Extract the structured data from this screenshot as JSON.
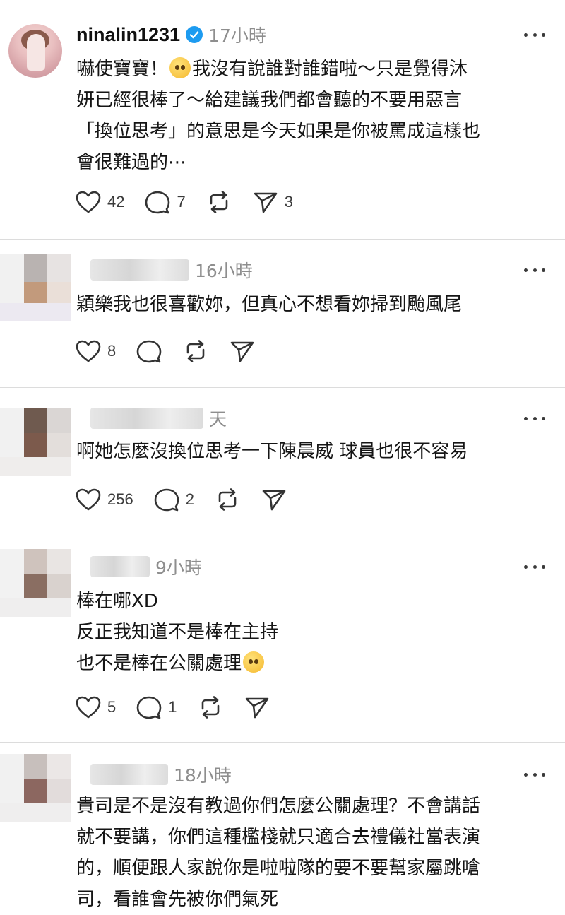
{
  "posts": [
    {
      "username": "ninalin1231",
      "verified": true,
      "time": "17小時",
      "text_before_emoji": "嚇使寶寶！",
      "text_after_emoji": "我沒有說誰對誰錯啦～只是覺得沐\n妍已經很棒了～給建議我們都會聽的不要用惡言\n「換位思考」的意思是今天如果是你被罵成這樣也\n會很難過的⋯",
      "emoji": "pleading-face-icon",
      "likes": "42",
      "replies": "7",
      "shares": "3"
    },
    {
      "time": "16小時",
      "text": "穎樂我也很喜歡妳，但真心不想看妳掃到颱風尾",
      "likes": "8"
    },
    {
      "time": "天",
      "text": "啊她怎麼沒換位思考一下陳晨威 球員也很不容易",
      "likes": "256",
      "replies": "2"
    },
    {
      "time": "9小時",
      "text_before_emoji": "棒在哪XD\n反正我知道不是棒在主持\n也不是棒在公關處理",
      "emoji": "relieved-face-icon",
      "likes": "5",
      "replies": "1"
    },
    {
      "time": "18小時",
      "text": "貴司是不是沒有教過你們怎麼公關處理？不會講話\n就不要講，你們這種檻棧就只適合去禮儀社當表演\n的，順便跟人家說你是啦啦隊的要不要幫家屬跳嗆\n司，看誰會先被你們氣死"
    }
  ],
  "colors": {
    "verified": "#1d9bf0",
    "time": "#8e8e8e",
    "divider": "#dcdcdc"
  }
}
